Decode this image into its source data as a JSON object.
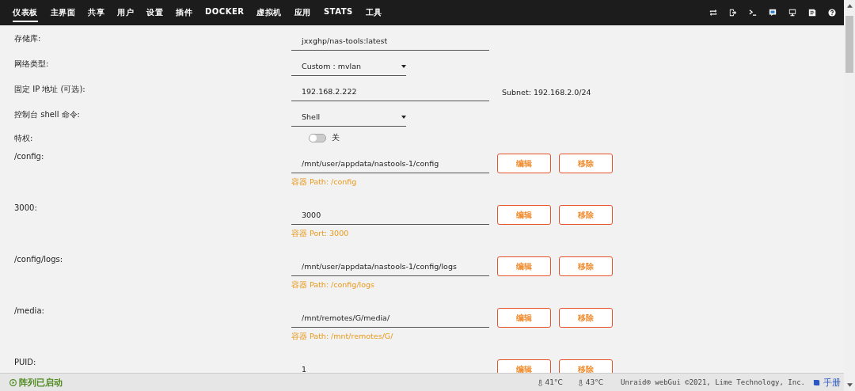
{
  "nav": {
    "items": [
      {
        "label": "仪表板",
        "selected": true
      },
      {
        "label": "主界面",
        "selected": false
      },
      {
        "label": "共享",
        "selected": false
      },
      {
        "label": "用户",
        "selected": false
      },
      {
        "label": "设置",
        "selected": false
      },
      {
        "label": "插件",
        "selected": false
      },
      {
        "label": "DOCKER",
        "selected": false
      },
      {
        "label": "虚拟机",
        "selected": false
      },
      {
        "label": "应用",
        "selected": false
      },
      {
        "label": "STATS",
        "selected": false
      },
      {
        "label": "工具",
        "selected": false
      }
    ],
    "icons": [
      {
        "kind": "switch"
      },
      {
        "kind": "logout"
      },
      {
        "kind": "terminal"
      },
      {
        "kind": "feedback"
      },
      {
        "kind": "monitor"
      },
      {
        "kind": "notes"
      },
      {
        "kind": "help"
      }
    ]
  },
  "form": [
    {
      "kind": "text",
      "label": "存储库:",
      "value": "jxxghp/nas-tools:latest"
    },
    {
      "kind": "select",
      "label": "网络类型:",
      "value": "Custom : mvlan"
    },
    {
      "kind": "text",
      "label": "固定 IP 地址 (可选):",
      "value": "192.168.2.222",
      "note": "Subnet: 192.168.2.0/24"
    },
    {
      "kind": "select",
      "label": "控制台 shell 命令:",
      "value": "Shell"
    },
    {
      "kind": "toggle",
      "label": "特权:",
      "on": false,
      "state_text": "关"
    },
    {
      "kind": "path",
      "label": "/config:",
      "value": "/mnt/user/appdata/nastools-1/config",
      "buttons": [
        "编辑",
        "移除"
      ],
      "hint": "容器 Path: /config"
    },
    {
      "kind": "path",
      "label": "3000:",
      "value": "3000",
      "buttons": [
        "编辑",
        "移除"
      ],
      "hint": "容器 Port: 3000"
    },
    {
      "kind": "path",
      "label": "/config/logs:",
      "value": "/mnt/user/appdata/nastools-1/config/logs",
      "buttons": [
        "编辑",
        "移除"
      ],
      "hint": "容器 Path: /config/logs"
    },
    {
      "kind": "path",
      "label": "/media:",
      "value": "/mnt/remotes/G/media/",
      "buttons": [
        "编辑",
        "移除"
      ],
      "hint": "容器 Path: /mnt/remotes/G/"
    },
    {
      "kind": "path",
      "label": "PUID:",
      "value": "1",
      "buttons": [
        "编辑",
        "移除"
      ]
    }
  ],
  "status_bar": {
    "array_status": "阵列已启动",
    "temps": [
      "41°C",
      "43°C"
    ],
    "copyright": "Unraid® webGui ©2021, Lime Technology, Inc.",
    "manual": "手册"
  }
}
